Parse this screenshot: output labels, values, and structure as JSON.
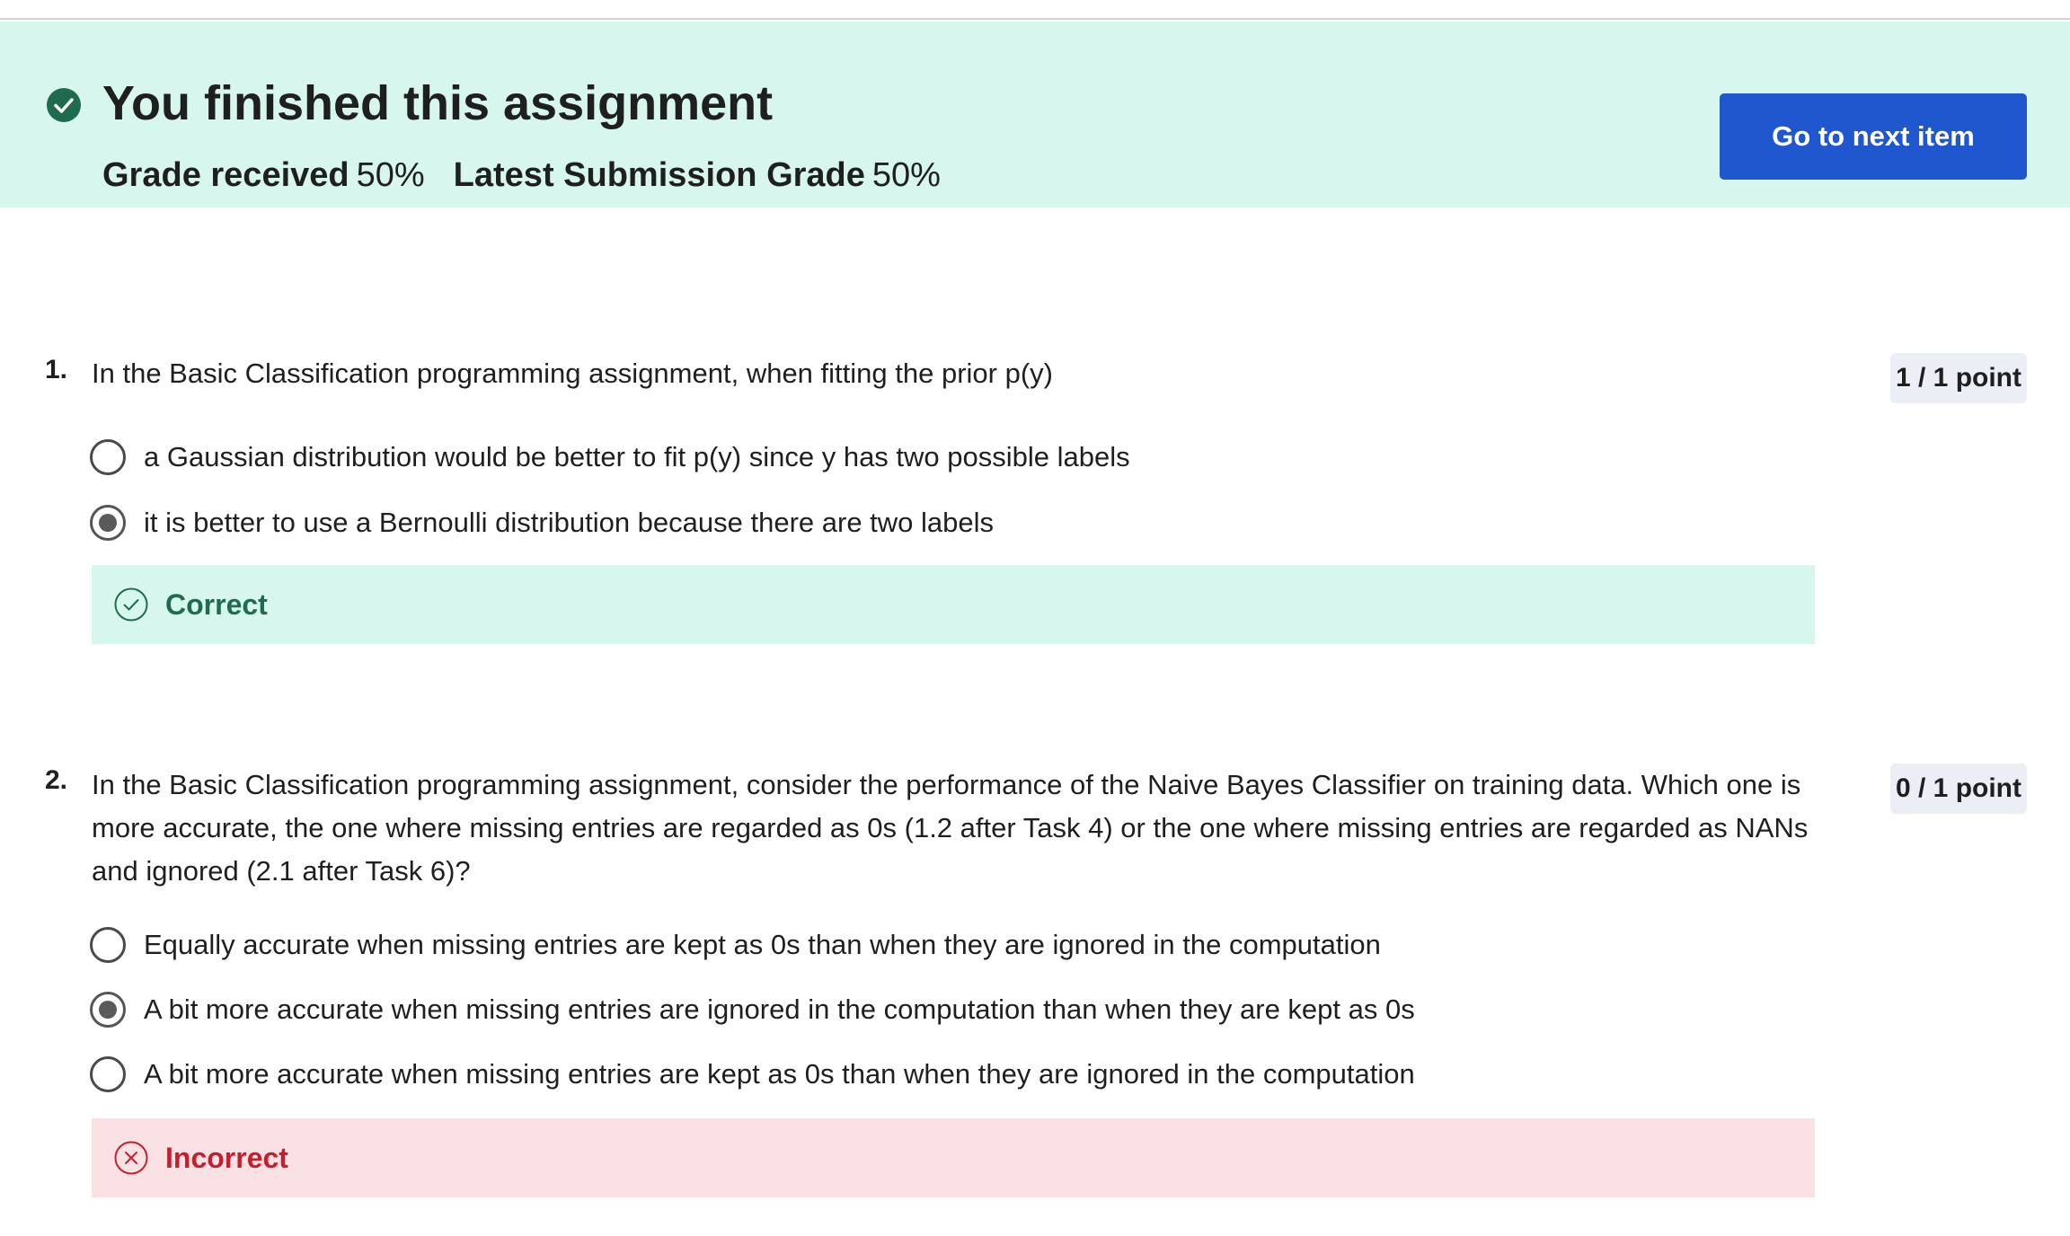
{
  "banner": {
    "title": "You finished this assignment",
    "grade_received_label": "Grade received",
    "grade_received_value": "50%",
    "latest_grade_label": "Latest Submission Grade",
    "latest_grade_value": "50%",
    "next_button_label": "Go to next item",
    "icon": "check-circle-icon"
  },
  "questions": [
    {
      "number": "1.",
      "text": "In the Basic Classification programming assignment, when fitting the prior p(y)",
      "points": "1 / 1 point",
      "options": [
        {
          "label": "a Gaussian distribution would be better to fit p(y)  since y has two possible labels",
          "selected": false
        },
        {
          "label": "it is better to use a Bernoulli distribution because there are two labels",
          "selected": true
        }
      ],
      "feedback": "Correct"
    },
    {
      "number": "2.",
      "text": "In the Basic Classification programming assignment, consider the performance of the Naive Bayes Classifier on training data. Which one is more accurate, the one where missing entries are regarded as 0s  (1.2 after Task 4) or the one where missing entries are regarded as NANs and ignored (2.1 after Task 6)?",
      "points": "0 / 1 point",
      "options": [
        {
          "label": "Equally accurate when missing entries are kept as 0s than when they are ignored in the computation",
          "selected": false
        },
        {
          "label": "A bit more accurate when missing entries are ignored in the computation than when they are kept as 0s",
          "selected": true
        },
        {
          "label": "A bit more accurate when missing entries are kept as 0s than when they are ignored in the computation",
          "selected": false
        }
      ],
      "feedback": "Incorrect"
    }
  ],
  "colors": {
    "success_bg": "#d7f7ee",
    "success_fg": "#1e6b4f",
    "error_bg": "#f9e1e4",
    "error_fg": "#c3202e",
    "primary_button": "#1f57cf",
    "points_badge_bg": "#ebeef5"
  }
}
